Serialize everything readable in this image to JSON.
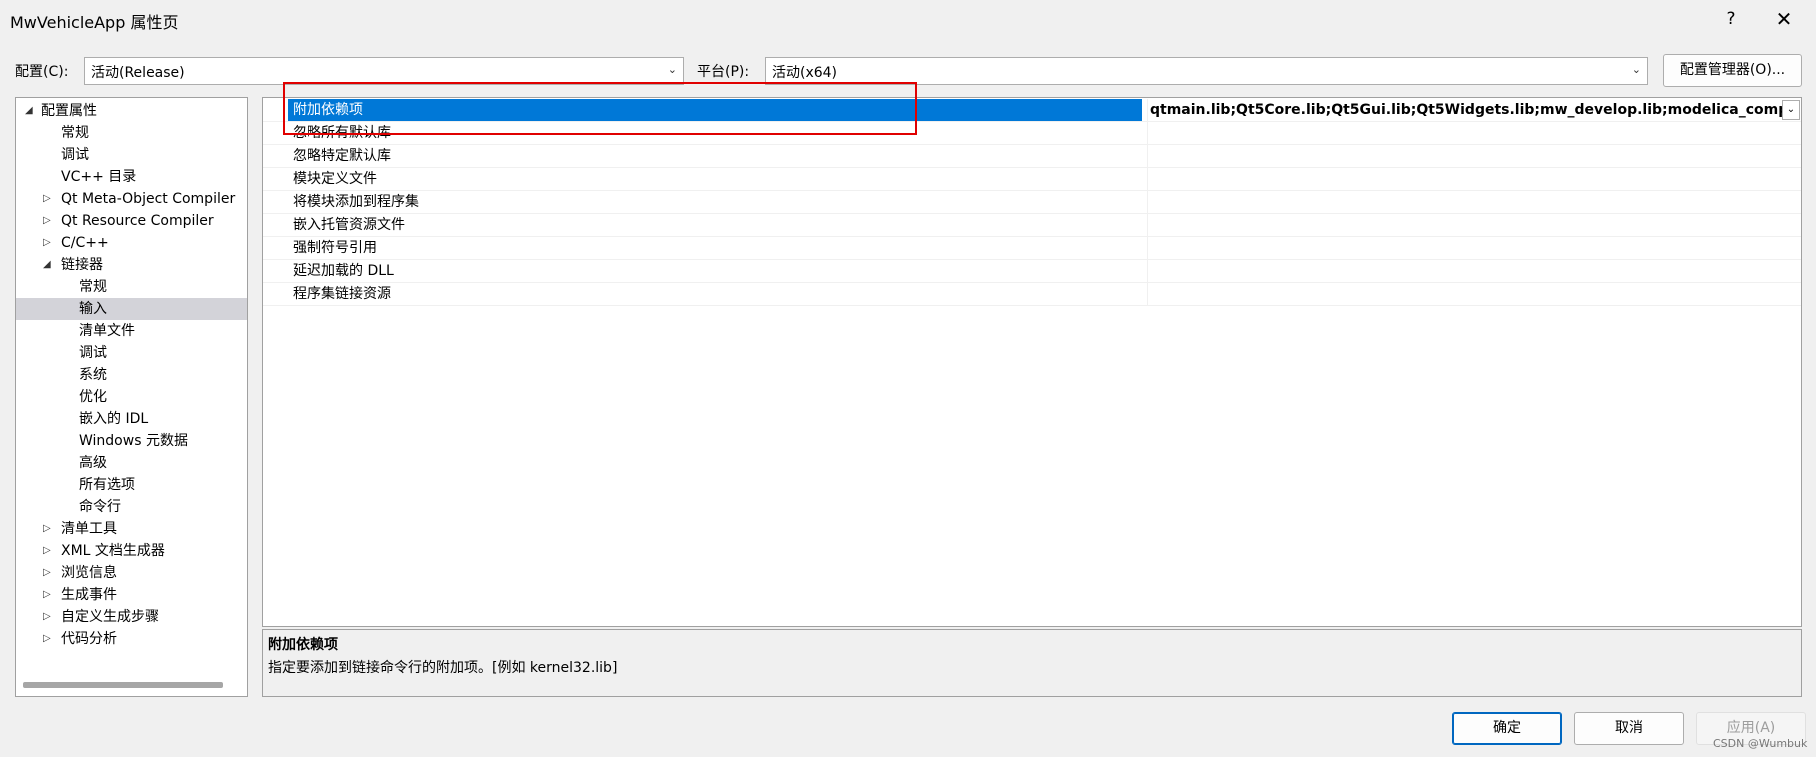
{
  "window": {
    "title": "MwVehicleApp 属性页",
    "help_label": "?",
    "close_label": "✕"
  },
  "config": {
    "config_label": "配置(C):",
    "config_value": "活动(Release)",
    "platform_label": "平台(P):",
    "platform_value": "活动(x64)",
    "manager_button": "配置管理器(O)..."
  },
  "tree": {
    "items": [
      {
        "label": "配置属性"
      },
      {
        "label": "常规"
      },
      {
        "label": "调试"
      },
      {
        "label": "VC++ 目录"
      },
      {
        "label": "Qt Meta-Object Compiler"
      },
      {
        "label": "Qt Resource Compiler"
      },
      {
        "label": "C/C++"
      },
      {
        "label": "链接器"
      },
      {
        "label": "常规"
      },
      {
        "label": "输入"
      },
      {
        "label": "清单文件"
      },
      {
        "label": "调试"
      },
      {
        "label": "系统"
      },
      {
        "label": "优化"
      },
      {
        "label": "嵌入的 IDL"
      },
      {
        "label": "Windows 元数据"
      },
      {
        "label": "高级"
      },
      {
        "label": "所有选项"
      },
      {
        "label": "命令行"
      },
      {
        "label": "清单工具"
      },
      {
        "label": "XML 文档生成器"
      },
      {
        "label": "浏览信息"
      },
      {
        "label": "生成事件"
      },
      {
        "label": "自定义生成步骤"
      },
      {
        "label": "代码分析"
      }
    ],
    "selected": "输入"
  },
  "properties": {
    "rows": [
      {
        "name": "附加依赖项",
        "value": "qtmain.lib;Qt5Core.lib;Qt5Gui.lib;Qt5Widgets.lib;mw_develop.lib;modelica_compiler.lib;mw_graphics_view.lib;mw_class_"
      },
      {
        "name": "忽略所有默认库",
        "value": ""
      },
      {
        "name": "忽略特定默认库",
        "value": ""
      },
      {
        "name": "模块定义文件",
        "value": ""
      },
      {
        "name": "将模块添加到程序集",
        "value": ""
      },
      {
        "name": "嵌入托管资源文件",
        "value": ""
      },
      {
        "name": "强制符号引用",
        "value": ""
      },
      {
        "name": "延迟加载的 DLL",
        "value": ""
      },
      {
        "name": "程序集链接资源",
        "value": ""
      }
    ]
  },
  "description": {
    "title": "附加依赖项",
    "text": "指定要添加到链接命令行的附加项。[例如 kernel32.lib]"
  },
  "buttons": {
    "ok": "确定",
    "cancel": "取消",
    "apply": "应用(A)"
  },
  "watermark": "CSDN @Wumbuk",
  "colors": {
    "selection": "#0078d7",
    "highlight_box": "#e00000",
    "tree_selected": "#d3d3d9"
  }
}
